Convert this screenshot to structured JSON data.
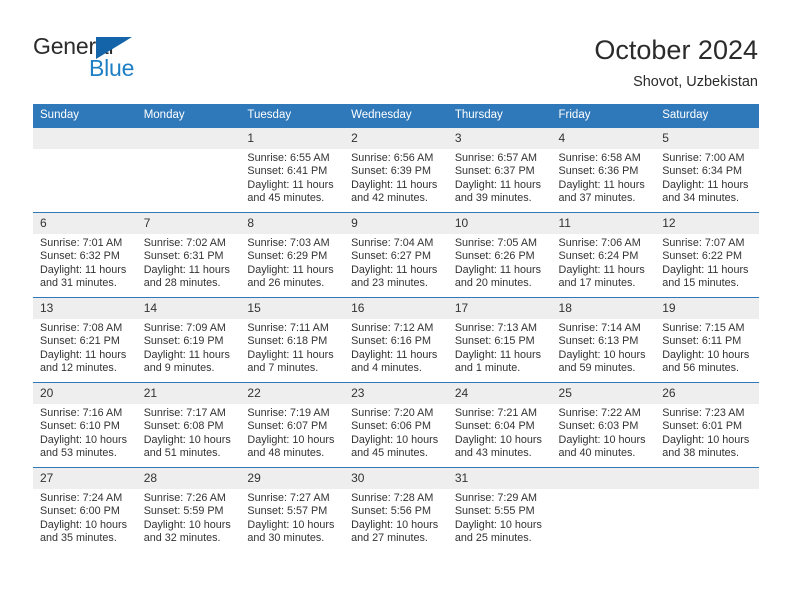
{
  "brand": {
    "name_top": "General",
    "name_bottom": "Blue",
    "logo_icon": "triangle-flag-icon",
    "color_dark": "#2b2b2b",
    "color_blue": "#1f7fc4",
    "color_triangle": "#1364a8"
  },
  "header": {
    "title": "October 2024",
    "subtitle": "Shovot, Uzbekistan"
  },
  "theme": {
    "header_row_bg": "#2f78b9",
    "daynum_bg": "#eeeeee",
    "text": "#333333",
    "page_bg": "#ffffff"
  },
  "calendar": {
    "weekday_headers": [
      "Sunday",
      "Monday",
      "Tuesday",
      "Wednesday",
      "Thursday",
      "Friday",
      "Saturday"
    ],
    "labels": {
      "sunrise_prefix": "Sunrise:",
      "sunset_prefix": "Sunset:",
      "daylight_prefix": "Daylight:"
    },
    "weeks": [
      [
        {
          "day": "",
          "sunrise": "",
          "sunset": "",
          "daylight": ""
        },
        {
          "day": "",
          "sunrise": "",
          "sunset": "",
          "daylight": ""
        },
        {
          "day": "1",
          "sunrise": "Sunrise: 6:55 AM",
          "sunset": "Sunset: 6:41 PM",
          "daylight": "Daylight: 11 hours and 45 minutes."
        },
        {
          "day": "2",
          "sunrise": "Sunrise: 6:56 AM",
          "sunset": "Sunset: 6:39 PM",
          "daylight": "Daylight: 11 hours and 42 minutes."
        },
        {
          "day": "3",
          "sunrise": "Sunrise: 6:57 AM",
          "sunset": "Sunset: 6:37 PM",
          "daylight": "Daylight: 11 hours and 39 minutes."
        },
        {
          "day": "4",
          "sunrise": "Sunrise: 6:58 AM",
          "sunset": "Sunset: 6:36 PM",
          "daylight": "Daylight: 11 hours and 37 minutes."
        },
        {
          "day": "5",
          "sunrise": "Sunrise: 7:00 AM",
          "sunset": "Sunset: 6:34 PM",
          "daylight": "Daylight: 11 hours and 34 minutes."
        }
      ],
      [
        {
          "day": "6",
          "sunrise": "Sunrise: 7:01 AM",
          "sunset": "Sunset: 6:32 PM",
          "daylight": "Daylight: 11 hours and 31 minutes."
        },
        {
          "day": "7",
          "sunrise": "Sunrise: 7:02 AM",
          "sunset": "Sunset: 6:31 PM",
          "daylight": "Daylight: 11 hours and 28 minutes."
        },
        {
          "day": "8",
          "sunrise": "Sunrise: 7:03 AM",
          "sunset": "Sunset: 6:29 PM",
          "daylight": "Daylight: 11 hours and 26 minutes."
        },
        {
          "day": "9",
          "sunrise": "Sunrise: 7:04 AM",
          "sunset": "Sunset: 6:27 PM",
          "daylight": "Daylight: 11 hours and 23 minutes."
        },
        {
          "day": "10",
          "sunrise": "Sunrise: 7:05 AM",
          "sunset": "Sunset: 6:26 PM",
          "daylight": "Daylight: 11 hours and 20 minutes."
        },
        {
          "day": "11",
          "sunrise": "Sunrise: 7:06 AM",
          "sunset": "Sunset: 6:24 PM",
          "daylight": "Daylight: 11 hours and 17 minutes."
        },
        {
          "day": "12",
          "sunrise": "Sunrise: 7:07 AM",
          "sunset": "Sunset: 6:22 PM",
          "daylight": "Daylight: 11 hours and 15 minutes."
        }
      ],
      [
        {
          "day": "13",
          "sunrise": "Sunrise: 7:08 AM",
          "sunset": "Sunset: 6:21 PM",
          "daylight": "Daylight: 11 hours and 12 minutes."
        },
        {
          "day": "14",
          "sunrise": "Sunrise: 7:09 AM",
          "sunset": "Sunset: 6:19 PM",
          "daylight": "Daylight: 11 hours and 9 minutes."
        },
        {
          "day": "15",
          "sunrise": "Sunrise: 7:11 AM",
          "sunset": "Sunset: 6:18 PM",
          "daylight": "Daylight: 11 hours and 7 minutes."
        },
        {
          "day": "16",
          "sunrise": "Sunrise: 7:12 AM",
          "sunset": "Sunset: 6:16 PM",
          "daylight": "Daylight: 11 hours and 4 minutes."
        },
        {
          "day": "17",
          "sunrise": "Sunrise: 7:13 AM",
          "sunset": "Sunset: 6:15 PM",
          "daylight": "Daylight: 11 hours and 1 minute."
        },
        {
          "day": "18",
          "sunrise": "Sunrise: 7:14 AM",
          "sunset": "Sunset: 6:13 PM",
          "daylight": "Daylight: 10 hours and 59 minutes."
        },
        {
          "day": "19",
          "sunrise": "Sunrise: 7:15 AM",
          "sunset": "Sunset: 6:11 PM",
          "daylight": "Daylight: 10 hours and 56 minutes."
        }
      ],
      [
        {
          "day": "20",
          "sunrise": "Sunrise: 7:16 AM",
          "sunset": "Sunset: 6:10 PM",
          "daylight": "Daylight: 10 hours and 53 minutes."
        },
        {
          "day": "21",
          "sunrise": "Sunrise: 7:17 AM",
          "sunset": "Sunset: 6:08 PM",
          "daylight": "Daylight: 10 hours and 51 minutes."
        },
        {
          "day": "22",
          "sunrise": "Sunrise: 7:19 AM",
          "sunset": "Sunset: 6:07 PM",
          "daylight": "Daylight: 10 hours and 48 minutes."
        },
        {
          "day": "23",
          "sunrise": "Sunrise: 7:20 AM",
          "sunset": "Sunset: 6:06 PM",
          "daylight": "Daylight: 10 hours and 45 minutes."
        },
        {
          "day": "24",
          "sunrise": "Sunrise: 7:21 AM",
          "sunset": "Sunset: 6:04 PM",
          "daylight": "Daylight: 10 hours and 43 minutes."
        },
        {
          "day": "25",
          "sunrise": "Sunrise: 7:22 AM",
          "sunset": "Sunset: 6:03 PM",
          "daylight": "Daylight: 10 hours and 40 minutes."
        },
        {
          "day": "26",
          "sunrise": "Sunrise: 7:23 AM",
          "sunset": "Sunset: 6:01 PM",
          "daylight": "Daylight: 10 hours and 38 minutes."
        }
      ],
      [
        {
          "day": "27",
          "sunrise": "Sunrise: 7:24 AM",
          "sunset": "Sunset: 6:00 PM",
          "daylight": "Daylight: 10 hours and 35 minutes."
        },
        {
          "day": "28",
          "sunrise": "Sunrise: 7:26 AM",
          "sunset": "Sunset: 5:59 PM",
          "daylight": "Daylight: 10 hours and 32 minutes."
        },
        {
          "day": "29",
          "sunrise": "Sunrise: 7:27 AM",
          "sunset": "Sunset: 5:57 PM",
          "daylight": "Daylight: 10 hours and 30 minutes."
        },
        {
          "day": "30",
          "sunrise": "Sunrise: 7:28 AM",
          "sunset": "Sunset: 5:56 PM",
          "daylight": "Daylight: 10 hours and 27 minutes."
        },
        {
          "day": "31",
          "sunrise": "Sunrise: 7:29 AM",
          "sunset": "Sunset: 5:55 PM",
          "daylight": "Daylight: 10 hours and 25 minutes."
        },
        {
          "day": "",
          "sunrise": "",
          "sunset": "",
          "daylight": ""
        },
        {
          "day": "",
          "sunrise": "",
          "sunset": "",
          "daylight": ""
        }
      ]
    ]
  }
}
